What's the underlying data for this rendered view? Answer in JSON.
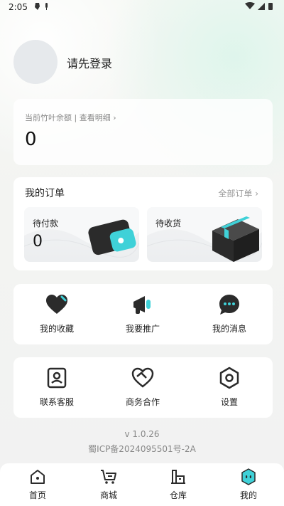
{
  "status_bar": {
    "time": "2:05"
  },
  "profile": {
    "login_prompt": "请先登录"
  },
  "balance": {
    "label": "当前竹叶余额 | 查看明细 ›",
    "value": "0"
  },
  "orders": {
    "title": "我的订单",
    "all_link": "全部订单 ›",
    "tiles": [
      {
        "label": "待付款",
        "count": "0"
      },
      {
        "label": "待收货"
      }
    ]
  },
  "functions_row1": [
    {
      "label": "我的收藏",
      "icon": "heart-icon"
    },
    {
      "label": "我要推广",
      "icon": "megaphone-icon"
    },
    {
      "label": "我的消息",
      "icon": "message-icon"
    }
  ],
  "functions_row2": [
    {
      "label": "联系客服",
      "icon": "contact-icon"
    },
    {
      "label": "商务合作",
      "icon": "handshake-icon"
    },
    {
      "label": "设置",
      "icon": "settings-icon"
    }
  ],
  "footer": {
    "version": "v 1.0.26",
    "icp": "蜀ICP备2024095501号-2A"
  },
  "tabbar": [
    {
      "label": "首页",
      "icon": "home-icon"
    },
    {
      "label": "商城",
      "icon": "cart-icon"
    },
    {
      "label": "仓库",
      "icon": "warehouse-icon"
    },
    {
      "label": "我的",
      "icon": "profile-icon",
      "active": true
    }
  ],
  "colors": {
    "accent": "#3fd1d8",
    "dark": "#2b2b2b"
  }
}
